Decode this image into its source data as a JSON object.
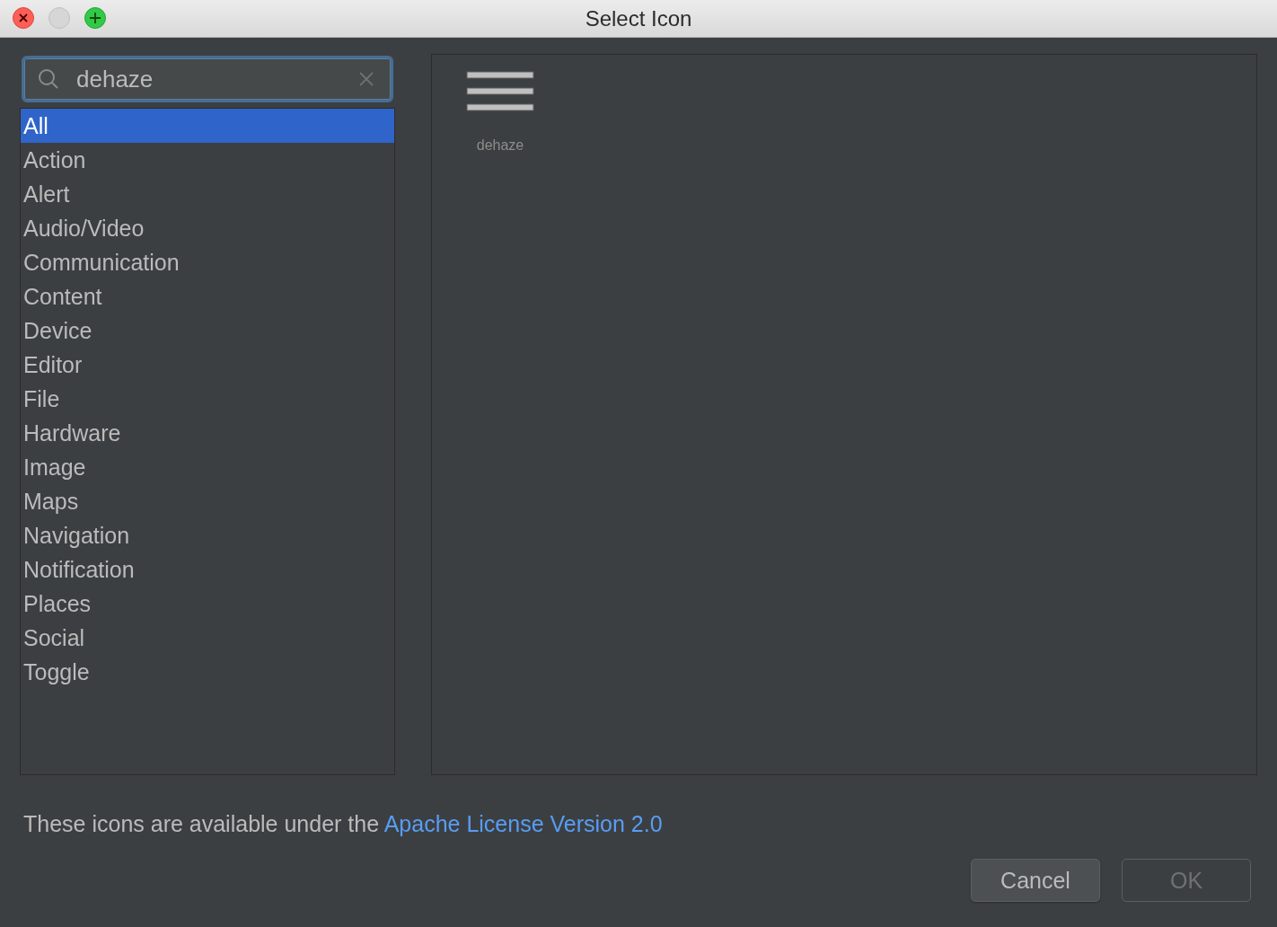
{
  "window": {
    "title": "Select Icon"
  },
  "search": {
    "value": "dehaze"
  },
  "categories": [
    {
      "label": "All",
      "selected": true
    },
    {
      "label": "Action",
      "selected": false
    },
    {
      "label": "Alert",
      "selected": false
    },
    {
      "label": "Audio/Video",
      "selected": false
    },
    {
      "label": "Communication",
      "selected": false
    },
    {
      "label": "Content",
      "selected": false
    },
    {
      "label": "Device",
      "selected": false
    },
    {
      "label": "Editor",
      "selected": false
    },
    {
      "label": "File",
      "selected": false
    },
    {
      "label": "Hardware",
      "selected": false
    },
    {
      "label": "Image",
      "selected": false
    },
    {
      "label": "Maps",
      "selected": false
    },
    {
      "label": "Navigation",
      "selected": false
    },
    {
      "label": "Notification",
      "selected": false
    },
    {
      "label": "Places",
      "selected": false
    },
    {
      "label": "Social",
      "selected": false
    },
    {
      "label": "Toggle",
      "selected": false
    }
  ],
  "icons": [
    {
      "label": "dehaze"
    }
  ],
  "footer": {
    "text": "These icons are available under the",
    "link": "Apache License Version 2.0"
  },
  "buttons": [
    {
      "label": "Cancel",
      "disabled": false
    },
    {
      "label": "OK",
      "disabled": true
    }
  ]
}
